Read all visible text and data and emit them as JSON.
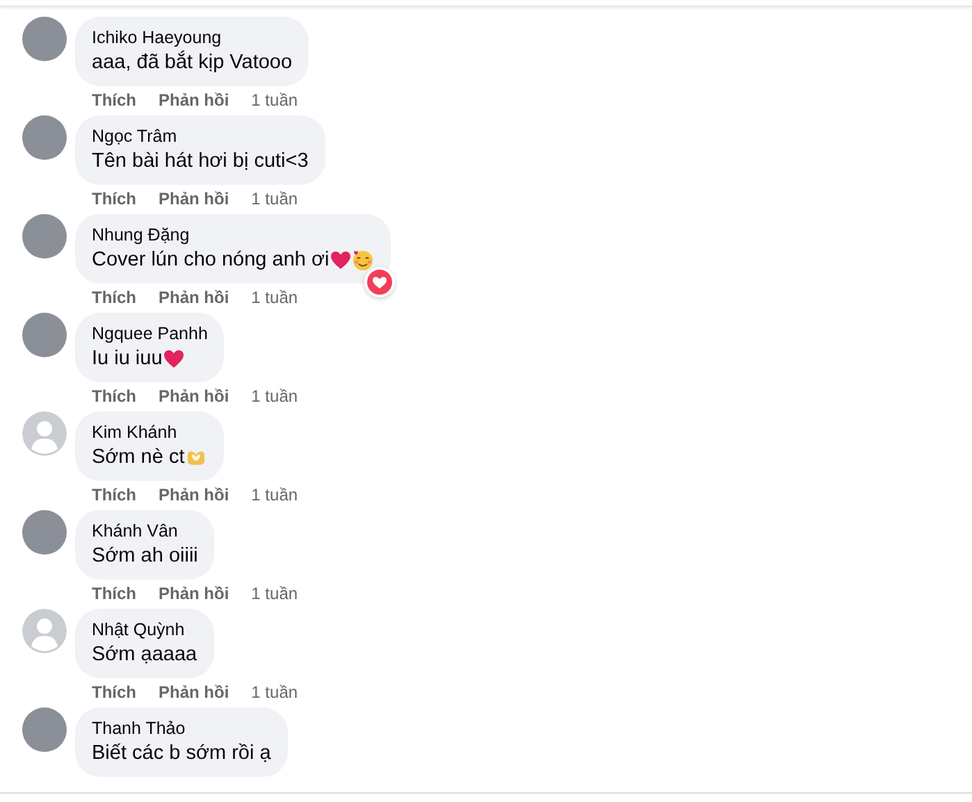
{
  "comments": [
    {
      "author": "Ichiko Haeyoung",
      "text": "aaa, đã bắt kịp Vatooo",
      "avatar": {
        "kind": "photo"
      },
      "actions": {
        "like": "Thích",
        "reply": "Phản hồi",
        "time": "1 tuần"
      }
    },
    {
      "author": "Ngọc Trâm",
      "text": "Tên bài hát hơi bị cuti<3",
      "avatar": {
        "kind": "photo"
      },
      "actions": {
        "like": "Thích",
        "reply": "Phản hồi",
        "time": "1 tuần"
      }
    },
    {
      "author": "Nhung Đặng",
      "text": "Cover lún cho nóng anh ơi",
      "avatar": {
        "kind": "photo"
      },
      "emojis": [
        {
          "kind": "heart"
        },
        {
          "kind": "smile-hearts"
        }
      ],
      "reaction": {
        "kind": "love"
      },
      "actions": {
        "like": "Thích",
        "reply": "Phản hồi",
        "time": "1 tuần"
      }
    },
    {
      "author": "Ngquee Panhh",
      "text": "Iu iu iuu",
      "avatar": {
        "kind": "photo"
      },
      "emojis": [
        {
          "kind": "heart"
        }
      ],
      "actions": {
        "like": "Thích",
        "reply": "Phản hồi",
        "time": "1 tuần"
      }
    },
    {
      "author": "Kim Khánh",
      "text": "Sớm nè ct",
      "avatar": {
        "kind": "default"
      },
      "emojis": [
        {
          "kind": "heart-hands"
        }
      ],
      "actions": {
        "like": "Thích",
        "reply": "Phản hồi",
        "time": "1 tuần"
      }
    },
    {
      "author": "Khánh Vân",
      "text": "Sớm ah oiiii",
      "avatar": {
        "kind": "photo"
      },
      "actions": {
        "like": "Thích",
        "reply": "Phản hồi",
        "time": "1 tuần"
      }
    },
    {
      "author": "Nhật Quỳnh",
      "text": "Sớm ạaaaa",
      "avatar": {
        "kind": "default"
      },
      "actions": {
        "like": "Thích",
        "reply": "Phản hồi",
        "time": "1 tuần"
      }
    },
    {
      "author": "Thanh Thảo",
      "text": "Biết các b sớm rồi ạ",
      "avatar": {
        "kind": "photo"
      }
    }
  ]
}
